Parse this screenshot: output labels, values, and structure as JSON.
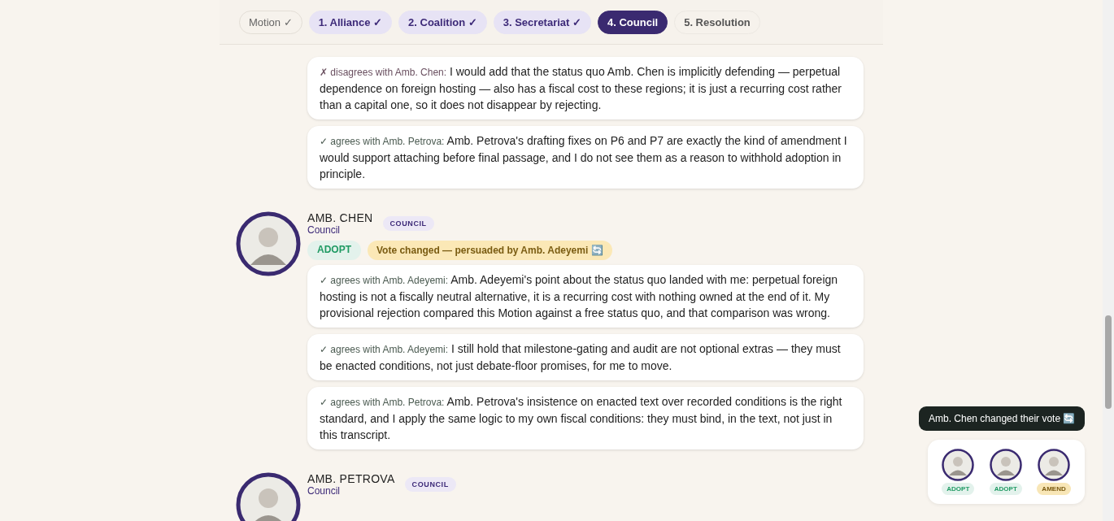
{
  "steps": [
    {
      "label": "Motion ✓",
      "kind": "motion",
      "selected": false
    },
    {
      "label": "1. Alliance ✓",
      "kind": "done",
      "selected": false
    },
    {
      "label": "2. Coalition ✓",
      "kind": "done",
      "selected": false
    },
    {
      "label": "3. Secretariat ✓",
      "kind": "done",
      "selected": false
    },
    {
      "label": "4. Council",
      "kind": "done",
      "selected": true
    },
    {
      "label": "5. Resolution",
      "kind": "pending",
      "selected": false
    }
  ],
  "thread_fragment": {
    "comments": [
      {
        "kind": "disagree",
        "marker": "✗",
        "attribution": "disagrees with Amb. Chen:",
        "text": "I would add that the status quo Amb. Chen is implicitly defending — perpetual dependence on foreign hosting — also has a fiscal cost to these regions; it is just a recurring cost rather than a capital one, so it does not disappear by rejecting."
      },
      {
        "kind": "agree",
        "marker": "✓",
        "attribution": "agrees with Amb. Petrova:",
        "text": "Amb. Petrova's drafting fixes on P6 and P7 are exactly the kind of amendment I would support attaching before final passage, and I do not see them as a reason to withhold adoption in principle."
      }
    ]
  },
  "delegates": [
    {
      "name": "AMB. CHEN",
      "body": "Council",
      "badge": "COUNCIL",
      "vote": {
        "label": "ADOPT",
        "kind": "adopt"
      },
      "note": "Vote changed — persuaded by Amb. Adeyemi 🔄",
      "comments": [
        {
          "kind": "agree",
          "marker": "✓",
          "attribution": "agrees with Amb. Adeyemi:",
          "text": "Amb. Adeyemi's point about the status quo landed with me: perpetual foreign hosting is not a fiscally neutral alternative, it is a recurring cost with nothing owned at the end of it. My provisional rejection compared this Motion against a free status quo, and that comparison was wrong."
        },
        {
          "kind": "agree",
          "marker": "✓",
          "attribution": "agrees with Amb. Adeyemi:",
          "text": "I still hold that milestone-gating and audit are not optional extras — they must be enacted conditions, not just debate-floor promises, for me to move."
        },
        {
          "kind": "agree",
          "marker": "✓",
          "attribution": "agrees with Amb. Petrova:",
          "text": "Amb. Petrova's insistence on enacted text over recorded conditions is the right standard, and I apply the same logic to my own fiscal conditions: they must bind, in the text, not just in this transcript."
        }
      ]
    },
    {
      "name": "AMB. PETROVA",
      "body": "Council",
      "badge": "COUNCIL"
    }
  ],
  "toast": "Amb. Chen changed their vote 🔄",
  "tally": [
    {
      "vote": "ADOPT",
      "kind": "adopt"
    },
    {
      "vote": "ADOPT",
      "kind": "adopt"
    },
    {
      "vote": "AMEND",
      "kind": "amend"
    }
  ]
}
